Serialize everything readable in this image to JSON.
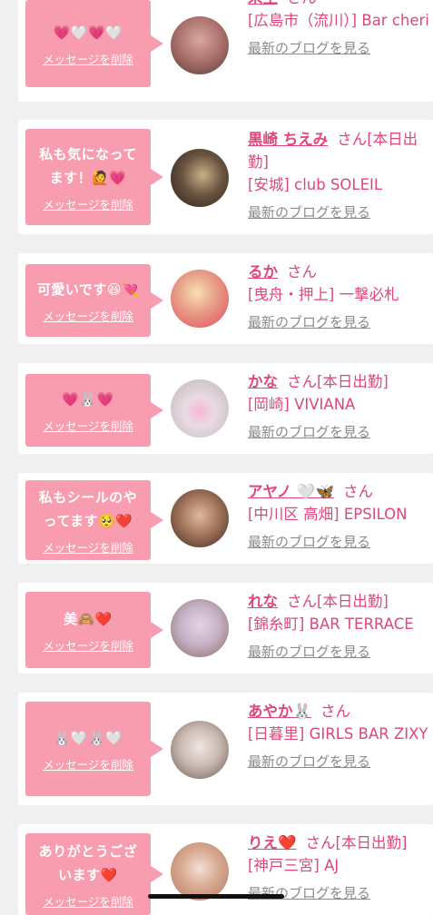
{
  "accent_color": "#e1467a",
  "bubble_color": "#f79daf",
  "delete_label": "メッセージを削除",
  "blog_label": "最新のブログを見る",
  "items": [
    {
      "message": "💗🤍💗🤍",
      "name": "未生",
      "suffix": "さん",
      "area": "[広島市（流川）] Bar cheri",
      "avatar_colors": [
        "#c9908a",
        "#5a3a36"
      ]
    },
    {
      "message": "私も気になってます！🙋💗",
      "name": "黒崎 ちえみ",
      "suffix": "さん[本日出勤]",
      "area": "[安城] club SOLEIL",
      "avatar_colors": [
        "#3a2a22",
        "#c8b08a"
      ]
    },
    {
      "message": "可愛いです😆💘",
      "name": "るか",
      "suffix": "さん",
      "area": "[曳舟・押上] 一撃必札",
      "avatar_colors": [
        "#e24a5c",
        "#f2d6a0"
      ]
    },
    {
      "message": "💗🐰💗",
      "name": "かな",
      "suffix": "さん[本日出勤]",
      "area": "[岡崎] VIVIANA",
      "avatar_colors": [
        "#d8d2d6",
        "#f7b6d6"
      ]
    },
    {
      "message": "私もシールのやってます🥺❤️",
      "name": "アヤノ 🤍🦋",
      "suffix": "さん",
      "area": "[中川区 高畑] EPSILON",
      "avatar_colors": [
        "#b98a6e",
        "#3c2a22"
      ]
    },
    {
      "message": "美🙈❤️",
      "name": "れな",
      "suffix": "さん[本日出勤]",
      "area": "[錦糸町] BAR TERRACE",
      "avatar_colors": [
        "#c6b2c8",
        "#8a6a5a"
      ]
    },
    {
      "message": "🐰🤍🐰🤍",
      "name": "あやか🐰",
      "suffix": "さん",
      "area": "[日暮里] GIRLS BAR ZIXY",
      "avatar_colors": [
        "#d8d0cc",
        "#6a5a52"
      ]
    },
    {
      "message": "ありがとうございます❤️",
      "name": "りえ❤️",
      "suffix": "さん[本日出勤]",
      "area": "[神戸三宮] AJ",
      "avatar_colors": [
        "#e8cfc0",
        "#b07a62"
      ]
    }
  ]
}
